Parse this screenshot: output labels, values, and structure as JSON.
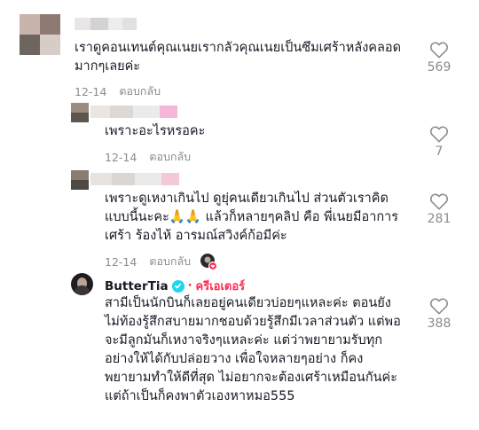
{
  "comments": [
    {
      "text": "เราดูคอนเทนต์คุณเนยเรากลัวคุณเนยเป็นซึมเศร้าหลังคลอด\nมากๆเลยค่ะ",
      "date": "12-14",
      "reply_label": "ตอบกลับ",
      "likes": "569"
    },
    {
      "text": "เพราะอะไรหรอคะ",
      "date": "12-14",
      "reply_label": "ตอบกลับ",
      "likes": "7"
    },
    {
      "text": "เพราะดูเหงาเกินไป ดูยุ่คนเดียวเกินไป ส่วนตัวเราคิด\nแบบนี้นะคะ🙏🙏 แล้วก็หลายๆคลิป คือ พี่เนยมีอาการ\nเศร้า ร้องไห้ อารมณ์สวิงค์ก้อมีค่ะ",
      "date": "12-14",
      "reply_label": "ตอบกลับ",
      "likes": "281"
    },
    {
      "username": "ButterTia",
      "creator_label": "ครีเอเตอร์",
      "creator_separator": "·",
      "text": "สามีเป็นนักบินก็เลยอยู่คนเดียวบ่อยๆแหละค่ะ ตอนยัง\nไม่ท้องรู้สึกสบายมากชอบด้วยรู้สึกมีเวลาส่วนตัว แต่พอ\nจะมีลูกมันก็เหงาจริงๆแหละค่ะ แต่ว่าพยายามรับทุก\nอย่างให้ได้กับปล่อยวาง เพื่อใจหลายๆอย่าง ก็คง\nพยายามทำให้ดีที่สุด ไม่อยากจะต้องเศร้าเหมือนกันค่ะ\nแต่ถ้าเป็นก็คงพาตัวเองหาหมอ555",
      "likes": "388"
    }
  ],
  "colors": {
    "text": "#161823",
    "secondary": "#8a8b91",
    "creator": "#fe2c55",
    "verified": "#20d5ec"
  },
  "icons": {
    "like": "heart-outline-icon",
    "verified": "verified-check-icon",
    "liked_by_creator": "creator-liked-badge-icon"
  }
}
